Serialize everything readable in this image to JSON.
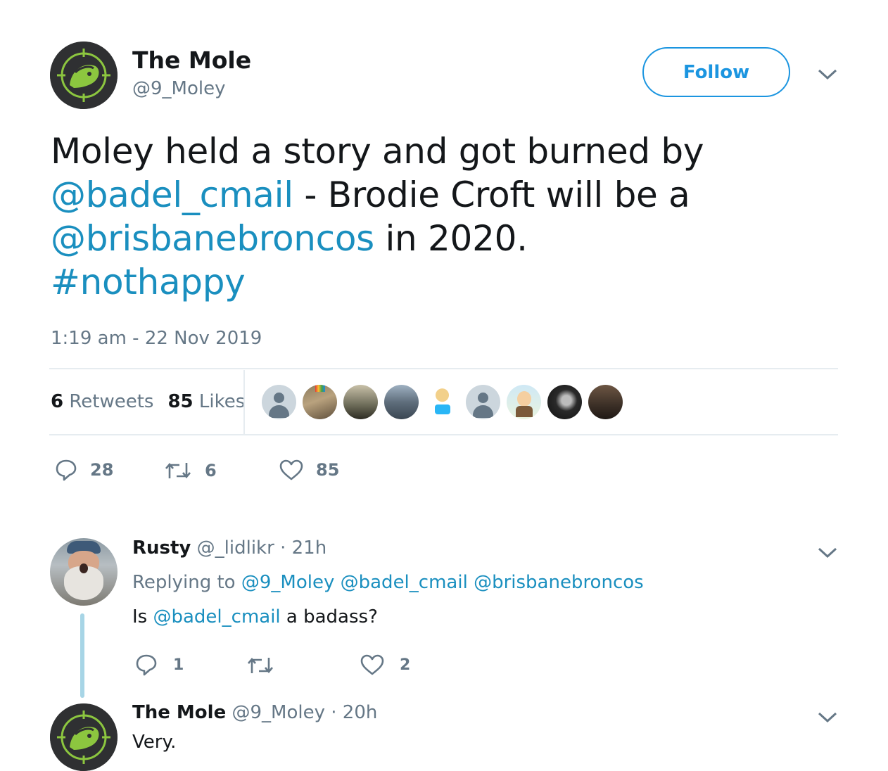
{
  "author": {
    "name": "The Mole",
    "handle": "@9_Moley",
    "avatar": "mole-logo-icon",
    "follow_label": "Follow"
  },
  "tweet": {
    "text_1": "Moley held a story and got burned by",
    "mention_1": "@badel_cmail",
    "text_2": " - Brodie Croft will be a",
    "mention_2": "@brisbanebroncos",
    "text_3": " in 2020.",
    "hashtag": "#nothappy",
    "timestamp": "1:19 am - 22 Nov 2019"
  },
  "stats": {
    "retweets_count": "6",
    "retweets_label": "Retweets",
    "likes_count": "85",
    "likes_label": "Likes"
  },
  "actions": {
    "replies": "28",
    "retweets": "6",
    "likes": "85"
  },
  "replies": [
    {
      "name": "Rusty",
      "handle": "@_lidlikr",
      "time": "· 21h",
      "replying_prefix": "Replying to",
      "replying_to": [
        "@9_Moley",
        "@badel_cmail",
        "@brisbanebroncos"
      ],
      "text_prefix": "Is",
      "text_mention": "@badel_cmail",
      "text_suffix": "a badass?",
      "replies": "1",
      "retweets": "",
      "likes": "2"
    },
    {
      "name": "The Mole",
      "handle": "@9_Moley",
      "time": "· 20h",
      "text": "Very."
    }
  ],
  "colors": {
    "link": "#1b95e0",
    "text": "#14171a",
    "muted": "#657786",
    "divider": "#e6ecf0",
    "thread": "#a7d5e6"
  }
}
